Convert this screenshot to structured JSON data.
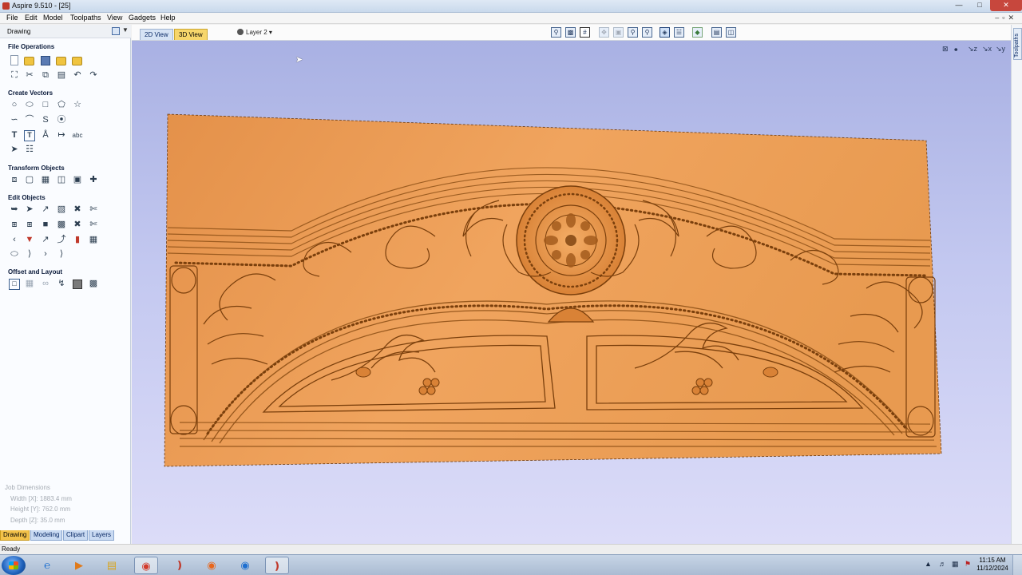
{
  "window": {
    "title": "Aspire 9.510 - [25]"
  },
  "menu": [
    "File",
    "Edit",
    "Model",
    "Toolpaths",
    "View",
    "Gadgets",
    "Help"
  ],
  "left_panel": {
    "header": "Drawing",
    "sections": {
      "file_operations": "File Operations",
      "create_vectors": "Create Vectors",
      "transform_objects": "Transform Objects",
      "edit_objects": "Edit Objects",
      "offset_and_layout": "Offset and Layout"
    },
    "job_dimensions": {
      "title": "Job Dimensions",
      "width": "Width  [X]: 1883.4 mm",
      "height": "Height [Y]: 762.0 mm",
      "depth": "Depth  [Z]: 35.0 mm"
    },
    "tabs": [
      "Drawing",
      "Modeling",
      "Clipart",
      "Layers"
    ],
    "active_tab": "Drawing"
  },
  "view_tabs": [
    "2D View",
    "3D View"
  ],
  "active_view": "3D View",
  "layer": "Layer 2",
  "right_panel_label": "Toolpaths",
  "status": "Ready",
  "colors": {
    "wood_light": "#f2a866",
    "wood_mid": "#e89a50",
    "wood_dark": "#8a4d14",
    "viewport_top": "#a9b1e3",
    "viewport_bottom": "#dcdcf8",
    "active_tab": "#f3c24a"
  },
  "taskbar": {
    "apps": [
      "ie-icon",
      "media-player-icon",
      "file-explorer-icon",
      "chrome-icon",
      "aspire-icon",
      "firefox-icon",
      "chrome-alt-icon",
      "aspire-active-icon"
    ],
    "time": "11:15 AM",
    "date": "11/12/2024"
  }
}
